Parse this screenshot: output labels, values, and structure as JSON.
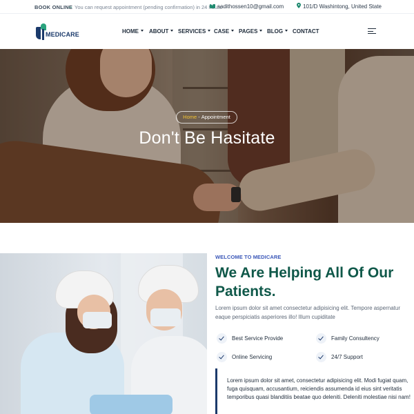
{
  "topbar": {
    "book_label": "BOOK ONLINE",
    "arrow_icon": "arrow-right-icon",
    "notice": "You can request appointment (pending confirmation) in 24 hours",
    "email": "sadithossen10@gmail.com",
    "address": "101/D Washintong, United State"
  },
  "brand": {
    "name": "MEDICARE"
  },
  "nav": {
    "items": [
      {
        "label": "HOME"
      },
      {
        "label": "ABOUT"
      },
      {
        "label": "SERVICES"
      },
      {
        "label": "CASE"
      },
      {
        "label": "PAGES"
      },
      {
        "label": "BLOG"
      },
      {
        "label": "CONTACT"
      }
    ]
  },
  "hero": {
    "breadcrumb_home": "Home",
    "breadcrumb_sep": "-",
    "breadcrumb_current": "Appointment",
    "title": "Don't Be Hasitate"
  },
  "about": {
    "eyebrow": "WELCOME TO MEDICARE",
    "heading": "We Are Helping All Of Our Patients.",
    "lead": "Lorem ipsum dolor sit amet consectetur adipisicing elit. Tempore aspernatur eaque perspiciatis asperiores illo! Illum cupiditate",
    "features": [
      "Best Service Provide",
      "Family Consultency",
      "Online Servicing",
      "24/7 Support"
    ],
    "quote": "Lorem ipsum dolor sit amet, consectetur adipisicing elit. Modi fugiat quam, fuga quisquam, accusantium, reiciendis assumenda id eius sint veritatis temporibus quasi blanditiis beatae quo deleniti. Deleniti molestiae nisi nam!"
  },
  "colors": {
    "brand_navy": "#1b3a6b",
    "brand_green": "#0f5849",
    "accent_yellow": "#f2c232",
    "eyebrow_blue": "#3a57b8"
  }
}
